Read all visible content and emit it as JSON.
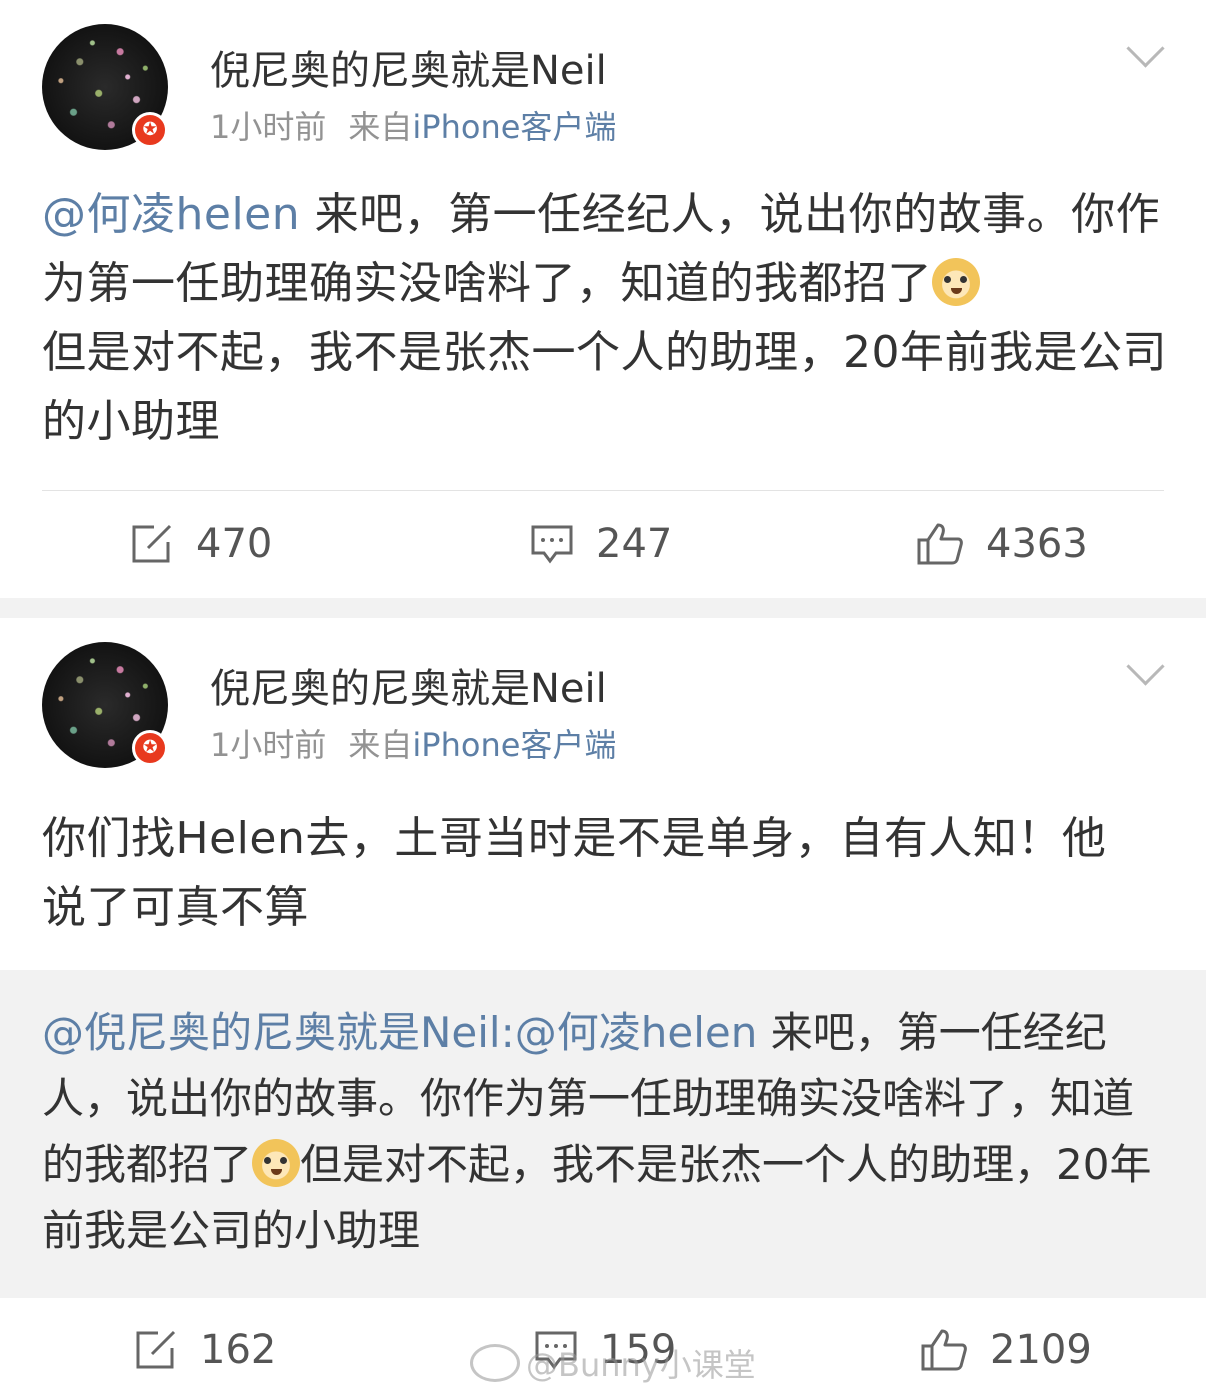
{
  "colors": {
    "link": "#5d7fa6",
    "meta": "#939393",
    "badge": "#e8391e",
    "quote_bg": "#f2f2f2"
  },
  "posts": [
    {
      "author": "倪尼奥的尼奥就是Neil",
      "time": "1小时前",
      "from": "来自",
      "client": "iPhone客户端",
      "mention": "@何凌helen",
      "text_1": " 来吧，第一任经纪人，说出你的故事。你作为第一任助理确实没啥料了，知道的我都招了",
      "emoji": "doge-emoji",
      "text_2": "但是对不起，我不是张杰一个人的助理，20年前我是公司的小助理",
      "repost_count": "470",
      "comment_count": "247",
      "like_count": "4363"
    },
    {
      "author": "倪尼奥的尼奥就是Neil",
      "time": "1小时前",
      "from": "来自",
      "client": "iPhone客户端",
      "text": "你们找Helen去，土哥当时是不是单身，自有人知！他说了可真不算",
      "quote": {
        "mention": "@倪尼奥的尼奥就是Neil:@何凌helen",
        "text_1": " 来吧，第一任经纪人，说出你的故事。你作为第一任助理确实没啥料了，知道的我都招了",
        "text_2": "但是对不起，我不是张杰一个人的助理，20年前我是公司的小助理"
      },
      "repost_count": "162",
      "comment_count": "159",
      "like_count": "2109"
    }
  ],
  "watermark": "@Bunny小课堂"
}
